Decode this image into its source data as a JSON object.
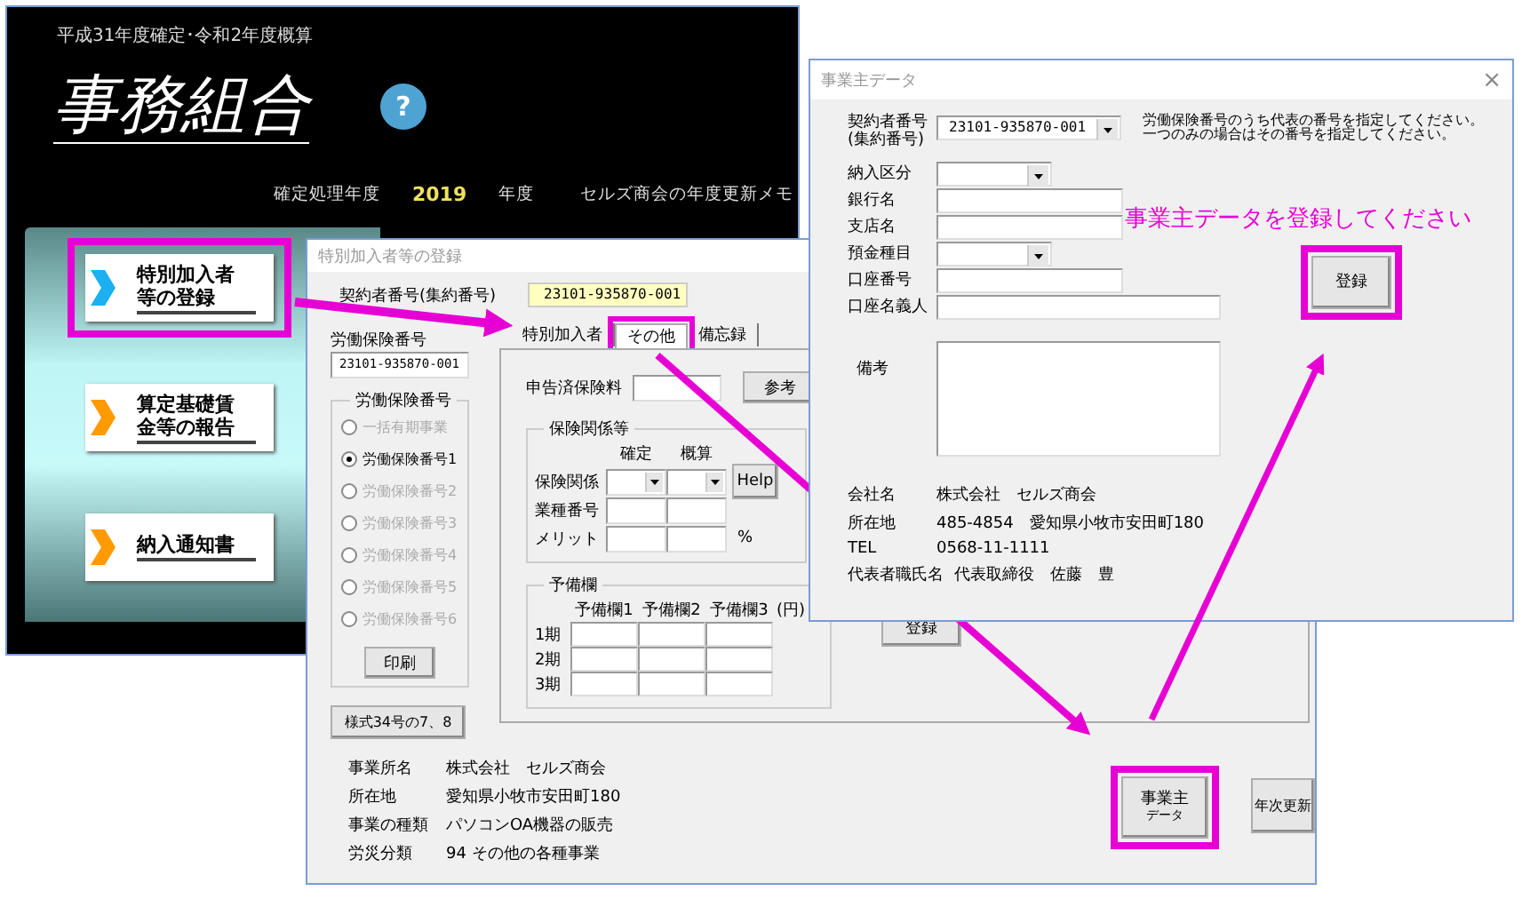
{
  "main_window": {
    "subtitle": "平成31年度確定･令和2年度概算",
    "title": "事務組合",
    "help": "?",
    "year_label": "確定処理年度",
    "year": "2019",
    "year_unit": "年度",
    "memo": "セルズ商会の年度更新メモ",
    "menu": [
      {
        "lines": [
          "特別加入者",
          "等の登録"
        ],
        "color": "#1cb0f0",
        "highlighted": true
      },
      {
        "lines": [
          "算定基礎賃",
          "金等の報告"
        ],
        "color": "#ff9a00",
        "highlighted": false
      },
      {
        "lines": [
          "納入通知書"
        ],
        "color": "#ff9a00",
        "highlighted": false
      }
    ]
  },
  "registration_dialog": {
    "title": "特別加入者等の登録",
    "contract_label": "契約者番号(集約番号)",
    "contract_value": "23101-935870-001",
    "insurance_label": "労働保険番号",
    "insurance_value": "23101-935870-001",
    "group_title": "労働保険番号",
    "radios": [
      {
        "label": "一括有期事業",
        "selected": false,
        "disabled": true
      },
      {
        "label": "労働保険番号1",
        "selected": true,
        "disabled": false
      },
      {
        "label": "労働保険番号2",
        "selected": false,
        "disabled": true
      },
      {
        "label": "労働保険番号3",
        "selected": false,
        "disabled": true
      },
      {
        "label": "労働保険番号4",
        "selected": false,
        "disabled": true
      },
      {
        "label": "労働保険番号5",
        "selected": false,
        "disabled": true
      },
      {
        "label": "労働保険番号6",
        "selected": false,
        "disabled": true
      }
    ],
    "print_button": "印刷",
    "form_button": "様式34号の7、8",
    "tabs": [
      {
        "label": "特別加入者",
        "selected": false,
        "highlighted": false
      },
      {
        "label": "その他",
        "selected": true,
        "highlighted": true
      },
      {
        "label": "備忘録",
        "selected": false,
        "highlighted": false
      }
    ],
    "declared_label": "申告済保険料",
    "reference_button": "参考",
    "insurance_group": {
      "title": "保険関係等",
      "columns": [
        "確定",
        "概算"
      ],
      "help_button": "Help",
      "rows": [
        {
          "label": "保険関係",
          "kind": "dropdown"
        },
        {
          "label": "業種番号",
          "kind": "text"
        },
        {
          "label": "メリット",
          "kind": "text",
          "unit": "%"
        }
      ]
    },
    "reserve_group": {
      "title": "予備欄",
      "columns": [
        "予備欄1",
        "予備欄2",
        "予備欄3"
      ],
      "unit": "(円)",
      "rows": [
        "1期",
        "2期",
        "3期"
      ]
    },
    "register_button": "登録",
    "info": [
      {
        "label": "事業所名",
        "value": "株式会社　セルズ商会"
      },
      {
        "label": "所在地",
        "value": "愛知県小牧市安田町180"
      },
      {
        "label": "事業の種類",
        "value": "パソコンOA機器の販売"
      },
      {
        "label": "労災分類",
        "value": "94 その他の各種事業"
      }
    ],
    "owner_button": {
      "lines": [
        "事業主",
        "データ"
      ],
      "highlighted": true
    },
    "annual_button": "年次更新"
  },
  "employer_dialog": {
    "title": "事業主データ",
    "close": "×",
    "contract_label": [
      "契約者番号",
      "(集約番号)"
    ],
    "contract_value": "23101-935870-001",
    "note": [
      "労働保険番号のうち代表の番号を指定してください。",
      "一つのみの場合はその番号を指定してください。"
    ],
    "fields": [
      {
        "label": "納入区分",
        "kind": "dropdown"
      },
      {
        "label": "銀行名",
        "kind": "text"
      },
      {
        "label": "支店名",
        "kind": "text"
      },
      {
        "label": "預金種目",
        "kind": "dropdown"
      },
      {
        "label": "口座番号",
        "kind": "text"
      },
      {
        "label": "口座名義人",
        "kind": "wide"
      }
    ],
    "hint": "事業主データを登録してください",
    "register_button": {
      "label": "登録",
      "highlighted": true
    },
    "remarks_label": "備考",
    "info": [
      {
        "label": "会社名",
        "value": "株式会社　セルズ商会"
      },
      {
        "label": "所在地",
        "value": "485-4854　愛知県小牧市安田町180"
      },
      {
        "label": "TEL",
        "value": "0568-11-1111"
      },
      {
        "label": "代表者職氏名",
        "value": "代表取締役　佐藤　豊"
      }
    ]
  }
}
